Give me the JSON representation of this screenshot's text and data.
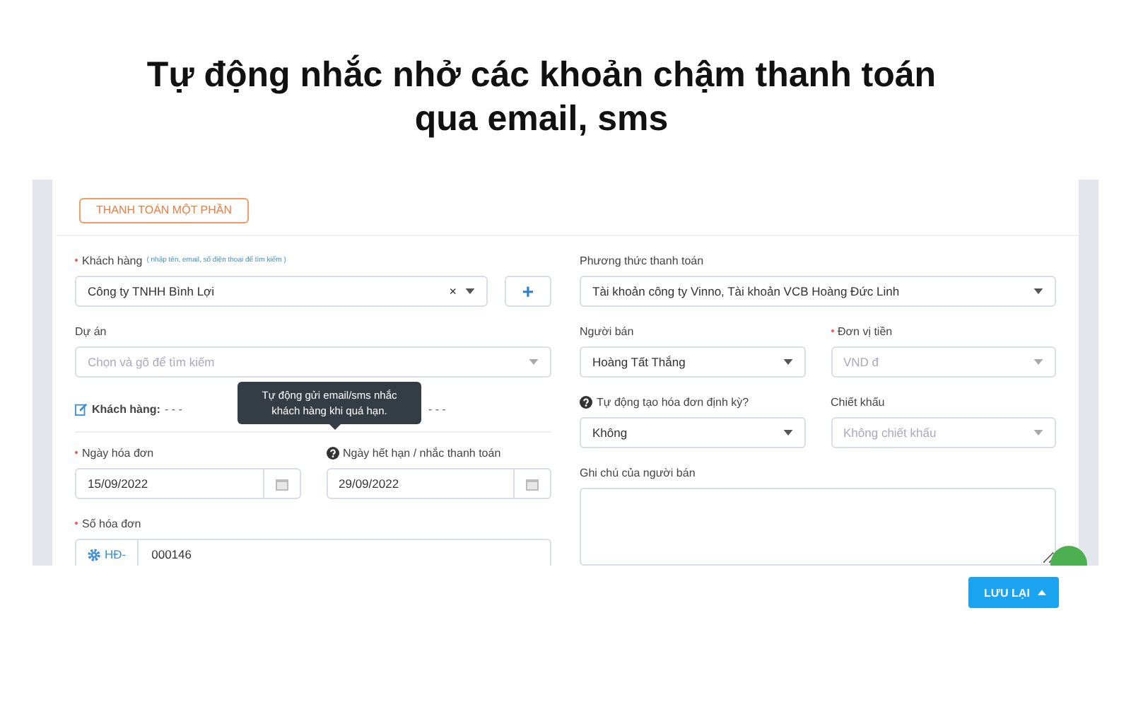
{
  "headline": {
    "lines": [
      "Tự động nhắc nhở các khoản chậm thanh toán",
      "qua email, sms"
    ]
  },
  "form": {
    "status_button": "THANH TOÁN MỘT PHẦN",
    "customer": {
      "label": "Khách hàng",
      "required": true,
      "hint": "( nhập tên, email, số điện thoại để tìm kiếm )",
      "value": "Công ty TNHH Bình Lợi",
      "clear": "×",
      "add": "+"
    },
    "project": {
      "label": "Dự án",
      "placeholder": "Chọn và gõ để tìm kiếm"
    },
    "customer_info": {
      "label": "Khách hàng:",
      "value": "- - -"
    },
    "shipping_value": "- - -",
    "tooltip": {
      "lines": [
        "Tự động gửi email/sms nhắc",
        "khách hàng khi quá hạn."
      ]
    },
    "invoice_date": {
      "label": "Ngày hóa đơn",
      "required": true,
      "value": "15/09/2022"
    },
    "due_date": {
      "label": "Ngày hết hạn / nhắc thanh toán",
      "required": false,
      "value": "29/09/2022"
    },
    "invoice_number": {
      "label": "Số hóa đơn",
      "required": true,
      "prefix": "HĐ-",
      "value": "000146"
    },
    "payment_method": {
      "label": "Phương thức thanh toán",
      "value": "Tài khoản công ty Vinno, Tài khoản VCB Hoàng Đức Linh"
    },
    "seller": {
      "label": "Người bán",
      "required": false,
      "value": "Hoàng Tất Thắng"
    },
    "currency": {
      "label": "Đơn vị tiền",
      "required": true,
      "placeholder": "VND đ"
    },
    "recurring": {
      "label": "Tự động tạo hóa đơn định kỳ?",
      "value": "Không"
    },
    "discount": {
      "label": "Chiết khấu",
      "required": false,
      "placeholder": "Không chiết khấu"
    },
    "note": {
      "label": "Ghi chú của người bán"
    }
  },
  "save_button": "LƯU LẠI"
}
